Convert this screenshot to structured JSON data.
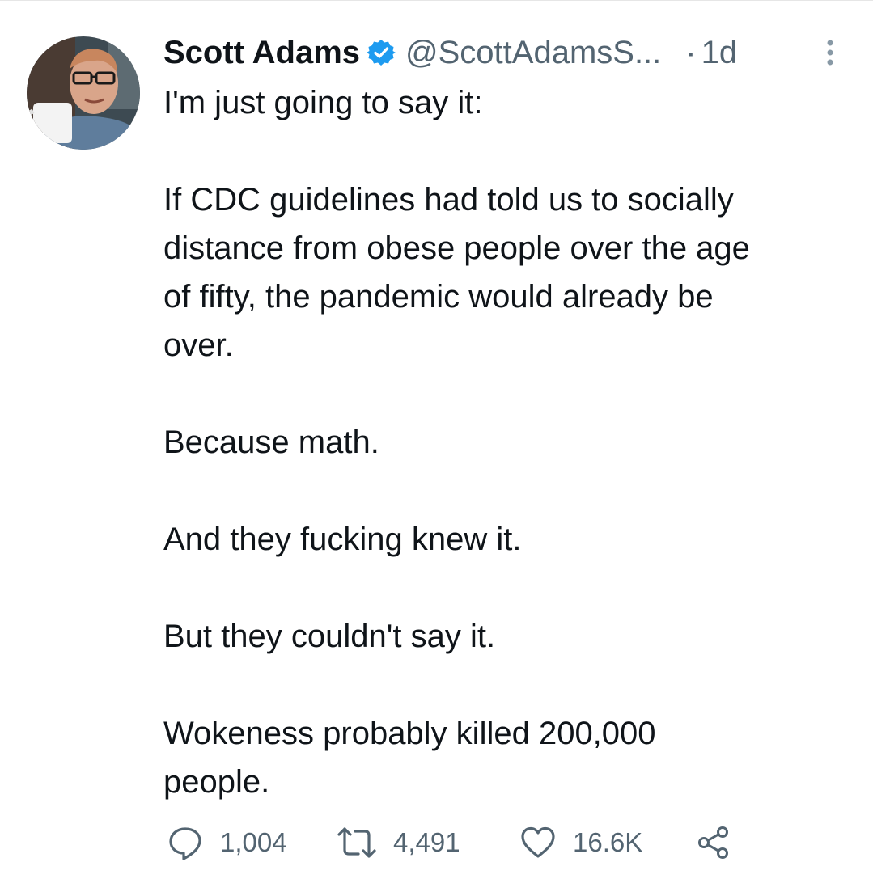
{
  "tweet": {
    "author": {
      "display_name": "Scott Adams",
      "handle": "@ScottAdamsS...",
      "verified": true
    },
    "separator": "·",
    "timestamp": "1d",
    "text_lines": [
      "I'm just going to say it:",
      "",
      "If CDC guidelines had told us to socially",
      "distance from obese people over the age",
      "of fifty, the pandemic would already be",
      "over.",
      "",
      "Because math.",
      "",
      "And they fucking knew it.",
      "",
      "But they couldn't say it.",
      "",
      "Wokeness probably killed 200,000",
      "people."
    ],
    "actions": {
      "replies": "1,004",
      "retweets": "4,491",
      "likes": "16.6K"
    }
  },
  "icons": [
    "verified-badge-icon",
    "more-options-icon",
    "reply-icon",
    "retweet-icon",
    "like-icon",
    "share-icon"
  ],
  "colors": {
    "text": "#0f1419",
    "secondary_text": "#536471",
    "verified": "#1d9bf0",
    "background": "#ffffff"
  }
}
